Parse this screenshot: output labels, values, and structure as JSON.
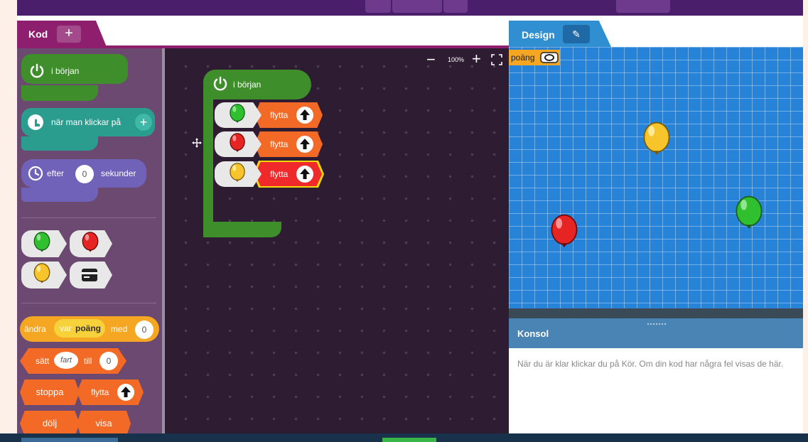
{
  "code_tab": {
    "label": "Kod",
    "add_label": "+"
  },
  "design_tab": {
    "label": "Design"
  },
  "palette": {
    "start_block": "i början",
    "click_block": "när man klickar på",
    "timer_block": {
      "prefix": "efter",
      "value": "0",
      "suffix": "sekunder"
    },
    "change_var": {
      "prefix": "ändra",
      "var_word": "var",
      "var_name": "poäng",
      "suffix": "med",
      "value": "0"
    },
    "set_prop": {
      "prefix": "sätt",
      "prop": "fart",
      "mid": "till",
      "value": "0"
    },
    "stop_label": "stoppa",
    "move_label": "flytta",
    "hide_label": "dölj",
    "show_label": "visa"
  },
  "workspace": {
    "zoom": "100%",
    "hat_label": "i början",
    "stack": [
      {
        "balloon": "green",
        "action": "flytta"
      },
      {
        "balloon": "red",
        "action": "flytta"
      },
      {
        "balloon": "yellow",
        "action": "flytta"
      }
    ]
  },
  "design": {
    "score_label": "poäng"
  },
  "console": {
    "title": "Konsol",
    "message": "När du är klar klickar du på Kör. Om din kod har några fel visas de här."
  },
  "colors": {
    "accent_purple": "#8d1f6e",
    "block_orange": "#f36a26",
    "block_green": "#3e8e2c",
    "canvas_blue": "#2683d8"
  },
  "icons": [
    "power-icon",
    "tap-icon",
    "timer-icon",
    "arrow-up-icon",
    "zoom-out-icon",
    "zoom-in-icon",
    "fit-screen-icon",
    "pencil-icon",
    "eye-icon",
    "card-icon",
    "move-cursor-icon"
  ]
}
